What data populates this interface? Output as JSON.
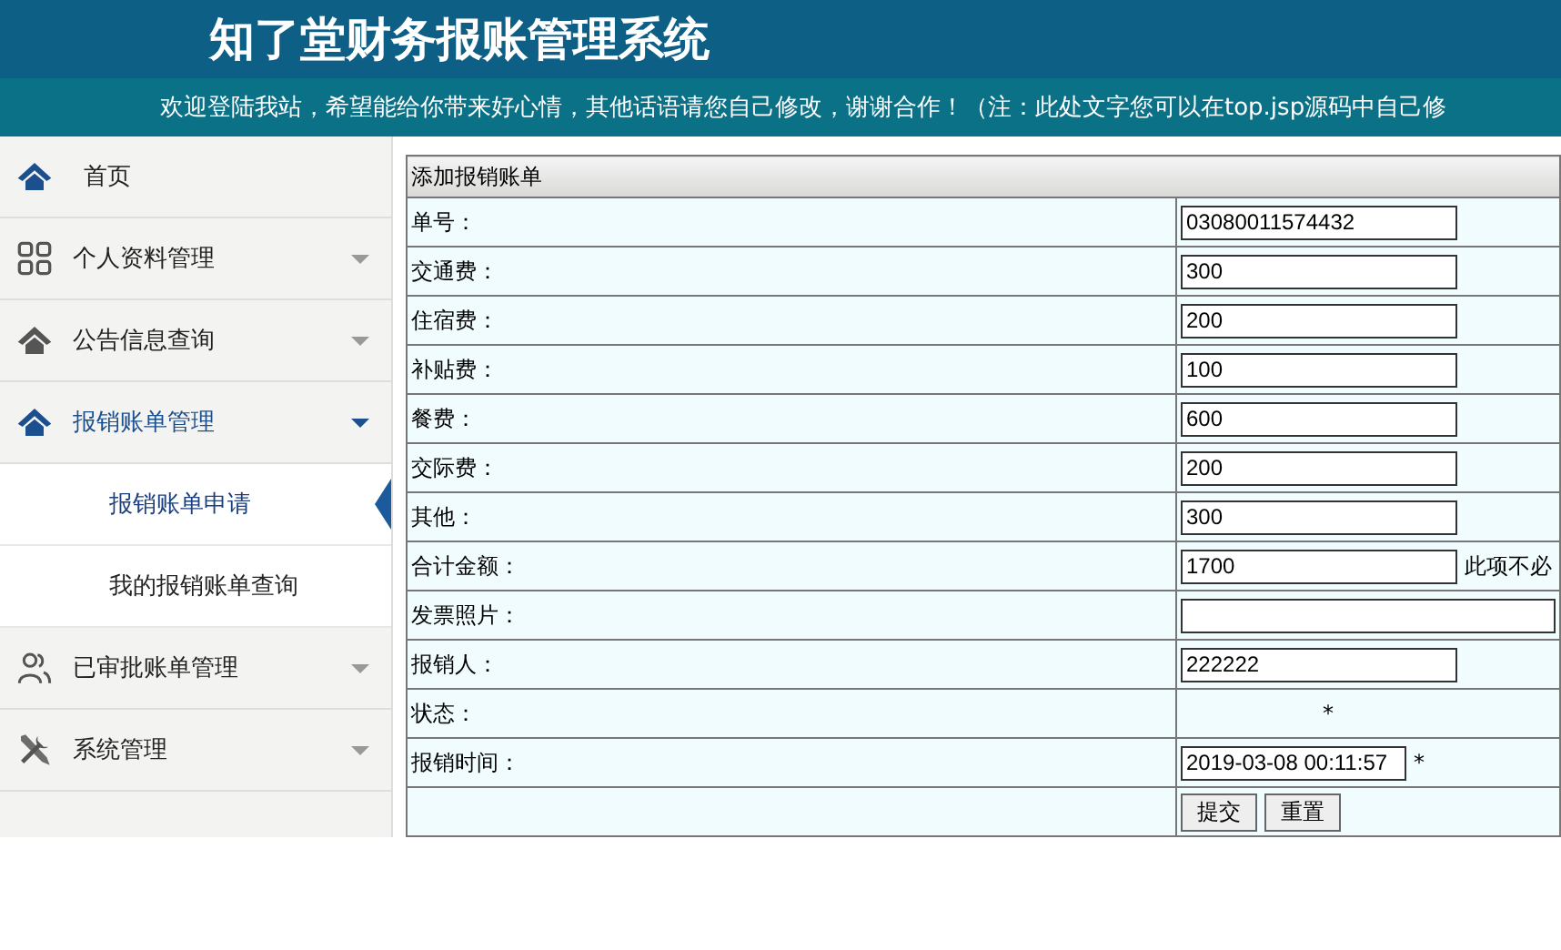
{
  "header": {
    "title": "知了堂财务报账管理系统",
    "notice": "欢迎登陆我站，希望能给你带来好心情，其他话语请您自己修改，谢谢合作！（注：此处文字您可以在top.jsp源码中自己修"
  },
  "sidebar": {
    "items": [
      {
        "label": "首页",
        "kind": "link",
        "selected": false
      },
      {
        "label": "个人资料管理",
        "kind": "menu",
        "expanded": false,
        "selected": false
      },
      {
        "label": "公告信息查询",
        "kind": "menu",
        "expanded": false,
        "selected": false
      },
      {
        "label": "报销账单管理",
        "kind": "menu",
        "expanded": true,
        "selected": false,
        "children": [
          {
            "label": "报销账单申请",
            "selected": true
          },
          {
            "label": "我的报销账单查询",
            "selected": false
          }
        ]
      },
      {
        "label": "已审批账单管理",
        "kind": "menu",
        "expanded": false,
        "selected": false
      },
      {
        "label": "系统管理",
        "kind": "menu",
        "expanded": false,
        "selected": false
      }
    ]
  },
  "form": {
    "title": "添加报销账单",
    "fields": [
      {
        "label": "单号：",
        "kind": "input",
        "value": "03080011574432"
      },
      {
        "label": "交通费：",
        "kind": "input",
        "value": "300"
      },
      {
        "label": "住宿费：",
        "kind": "input",
        "value": "200"
      },
      {
        "label": "补贴费：",
        "kind": "input",
        "value": "100"
      },
      {
        "label": "餐费：",
        "kind": "input",
        "value": "600"
      },
      {
        "label": "交际费：",
        "kind": "input",
        "value": "200"
      },
      {
        "label": "其他：",
        "kind": "input",
        "value": "300"
      },
      {
        "label": "合计金额：",
        "kind": "input",
        "value": "1700",
        "note": "此项不必"
      },
      {
        "label": "发票照片：",
        "kind": "file"
      },
      {
        "label": "报销人：",
        "kind": "input",
        "value": "222222"
      },
      {
        "label": "状态：",
        "kind": "text",
        "value": "*"
      },
      {
        "label": "报销时间：",
        "kind": "input",
        "value": "2019-03-08 00:11:57",
        "note": "*"
      }
    ],
    "buttons": [
      "提交",
      "重置"
    ]
  }
}
